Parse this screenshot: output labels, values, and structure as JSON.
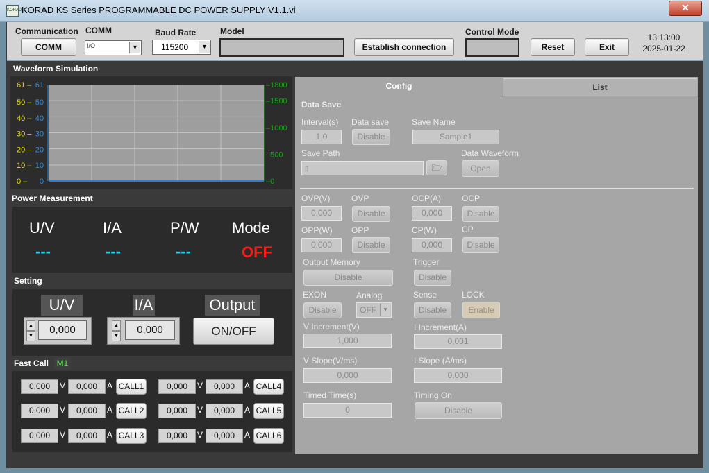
{
  "window": {
    "title": "KORAD  KS Series  PROGRAMMABLE DC POWER SUPPLY  V1.1.vi",
    "icon_text": "KORAD",
    "close_glyph": "✕"
  },
  "toolbar": {
    "communication_label": "Communication",
    "comm_button": "COMM",
    "comm_label": "COMM",
    "comm_value": "",
    "baud_label": "Baud Rate",
    "baud_value": "115200",
    "model_label": "Model",
    "model_value": "",
    "establish_button": "Establish connection",
    "control_mode_label": "Control Mode",
    "control_mode_value": "",
    "reset_button": "Reset",
    "exit_button": "Exit",
    "time": "13:13:00",
    "date": "2025-01-22"
  },
  "waveform": {
    "title": "Waveform Simulation"
  },
  "chart_data": {
    "type": "line",
    "title": "",
    "yellow_axis": {
      "ticks": [
        "0",
        "10",
        "20",
        "30",
        "40",
        "50",
        "61"
      ],
      "color": "#e8e000"
    },
    "blue_axis": {
      "ticks": [
        "0",
        "10",
        "20",
        "30",
        "40",
        "50",
        "61"
      ],
      "color": "#2a90e8"
    },
    "green_axis": {
      "ticks": [
        "0",
        "500",
        "1000",
        "1500",
        "1800"
      ],
      "color": "#1aa01a"
    },
    "ylim_left": [
      0,
      61
    ],
    "ylim_right": [
      0,
      1800
    ],
    "grid": true,
    "series": [
      {
        "values": [
          0,
          0
        ]
      }
    ]
  },
  "power": {
    "title": "Power  Measurement",
    "headers": [
      "U/V",
      "I/A",
      "P/W",
      "Mode"
    ],
    "values": [
      "---",
      "---",
      "---",
      "OFF"
    ]
  },
  "setting": {
    "title": "Setting",
    "u_label": "U/V",
    "i_label": "I/A",
    "output_label": "Output",
    "u_value": "0,000",
    "i_value": "0,000",
    "onoff_button": "ON/OFF"
  },
  "fastcall": {
    "title": "Fast Call",
    "memory": "M1",
    "v_unit": "V",
    "a_unit": "A",
    "rows": [
      {
        "v": "0,000",
        "a": "0,000",
        "call": "CALL1"
      },
      {
        "v": "0,000",
        "a": "0,000",
        "call": "CALL2"
      },
      {
        "v": "0,000",
        "a": "0,000",
        "call": "CALL3"
      },
      {
        "v": "0,000",
        "a": "0,000",
        "call": "CALL4"
      },
      {
        "v": "0,000",
        "a": "0,000",
        "call": "CALL5"
      },
      {
        "v": "0,000",
        "a": "0,000",
        "call": "CALL6"
      }
    ]
  },
  "tabs": [
    "Config",
    "List"
  ],
  "config": {
    "data_save_title": "Data Save",
    "interval_label": "Interval(s)",
    "interval_value": "1,0",
    "data_save_label": "Data save",
    "data_save_button": "Disable",
    "save_name_label": "Save Name",
    "save_name_value": "Sample1",
    "save_path_label": "Save Path",
    "save_path_value": "",
    "data_waveform_label": "Data Waveform",
    "open_button": "Open",
    "ovp_v_label": "OVP(V)",
    "ovp_v_value": "0,000",
    "ovp_label": "OVP",
    "ovp_button": "Disable",
    "ocp_a_label": "OCP(A)",
    "ocp_a_value": "0,000",
    "ocp_label": "OCP",
    "ocp_button": "Disable",
    "opp_w_label": "OPP(W)",
    "opp_w_value": "0,000",
    "opp_label": "OPP",
    "opp_button": "Disable",
    "cp_w_label": "CP(W)",
    "cp_w_value": "0,000",
    "cp_label": "CP",
    "cp_button": "Disable",
    "output_memory_label": "Output Memory",
    "output_memory_button": "Disable",
    "trigger_label": "Trigger",
    "trigger_button": "Disable",
    "exon_label": "EXON",
    "exon_button": "Disable",
    "analog_label": "Analog",
    "analog_value": "OFF",
    "sense_label": "Sense",
    "sense_button": "Disable",
    "lock_label": "LOCK",
    "lock_button": "Enable",
    "v_increment_label": "V Increment(V)",
    "v_increment_value": "1,000",
    "i_increment_label": "I Increment(A)",
    "i_increment_value": "0,001",
    "v_slope_label": "V Slope(V/ms)",
    "v_slope_value": "0,000",
    "i_slope_label": "I Slope (A/ms)",
    "i_slope_value": "0,000",
    "timed_time_label": "Timed Time(s)",
    "timed_time_value": "0",
    "timing_on_label": "Timing On",
    "timing_on_button": "Disable"
  },
  "colors": {
    "mode_off": "#ff1a1a",
    "dash": "#19d4e8",
    "accent": "#7aa6c8"
  }
}
